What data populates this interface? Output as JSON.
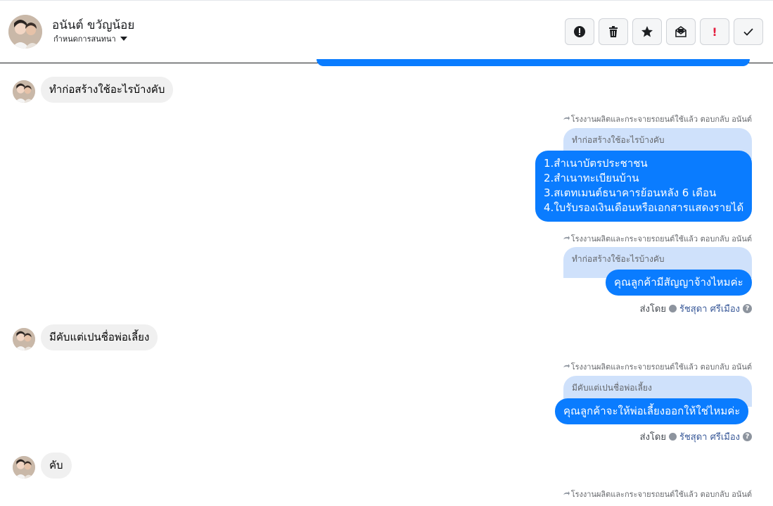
{
  "header": {
    "contact_name": "อนันต์ ขวัญน้อย",
    "assign_label": "กำหนดการสนทนา",
    "actions": [
      {
        "icon": "alert-circle-icon"
      },
      {
        "icon": "trash-icon"
      },
      {
        "icon": "star-icon"
      },
      {
        "icon": "mark-unread-icon"
      },
      {
        "icon": "exclamation-icon",
        "glyph": "!"
      },
      {
        "icon": "check-icon"
      }
    ]
  },
  "messages": {
    "m1": {
      "text": "ทำก่อสร้างใช้อะไรบ้างคับ"
    },
    "r1": {
      "meta": "โรงงานผลิตและกระจายรถยนต์ใช้แล้ว ตอบกลับ อนันต์",
      "quote": "ทำก่อสร้างใช้อะไรบ้างคับ",
      "lines": [
        "1.สำเนาบัตรประชาชน",
        "2.สำเนาทะเบียนบ้าน",
        "3.สเตทเมนต์ธนาคารย้อนหลัง 6 เดือน",
        "4.ใบรับรองเงินเดือนหรือเอกสารแสดงรายได้"
      ]
    },
    "r2": {
      "meta": "โรงงานผลิตและกระจายรถยนต์ใช้แล้ว ตอบกลับ อนันต์",
      "quote": "ทำก่อสร้างใช้อะไรบ้างคับ",
      "text": "คุณลูกค้ามีสัญญาจ้างไหมค่ะ",
      "sent_by_label": "ส่งโดย",
      "sender": "รัชสุดา ศรีเมือง"
    },
    "m2": {
      "text": "มีคับแต่เปนชื่อพ่อเลี้ยง"
    },
    "r3": {
      "meta": "โรงงานผลิตและกระจายรถยนต์ใช้แล้ว ตอบกลับ อนันต์",
      "quote": "มีคับแต่เปนชื่อพ่อเลี้ยง",
      "text": "คุณลูกค้าจะให้พ่อเลี้ยงออกให้ใช่ไหมค่ะ",
      "sent_by_label": "ส่งโดย",
      "sender": "รัชสุดา ศรีเมือง"
    },
    "m3": {
      "text": "คับ"
    },
    "r4": {
      "meta": "โรงงานผลิตและกระจายรถยนต์ใช้แล้ว ตอบกลับ อนันต์"
    }
  },
  "help_glyph": "?"
}
